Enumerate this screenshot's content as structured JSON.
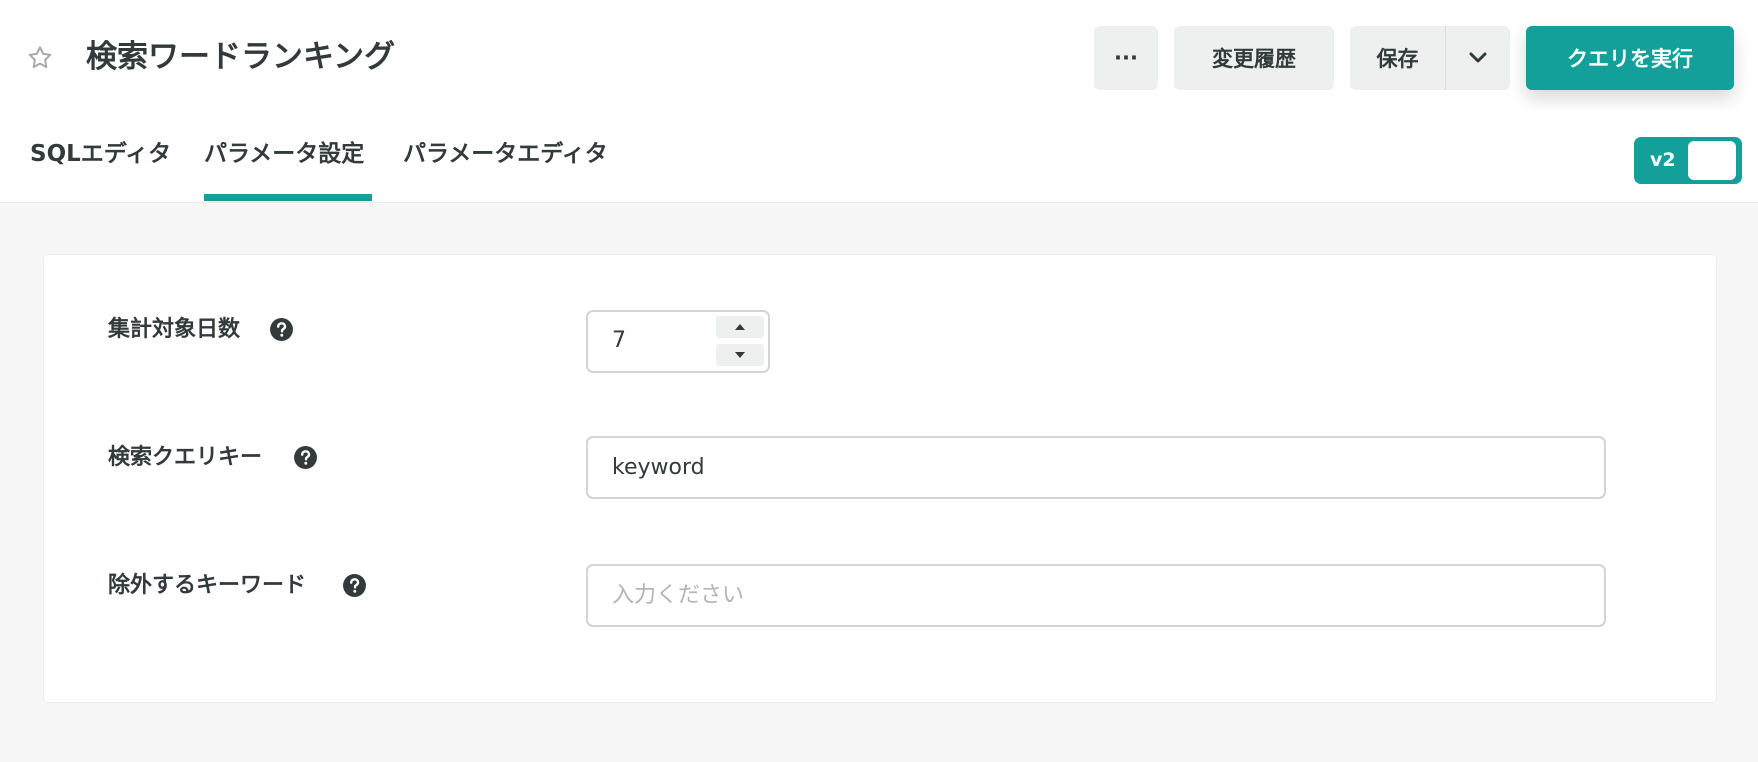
{
  "header": {
    "title": "検索ワードランキング",
    "more_label": "···",
    "history_label": "変更履歴",
    "save_label": "保存",
    "run_label": "クエリを実行"
  },
  "tabs": [
    {
      "label": "SQLエディタ",
      "active": false
    },
    {
      "label": "パラメータ設定",
      "active": true
    },
    {
      "label": "パラメータエディタ",
      "active": false
    }
  ],
  "toggle": {
    "label": "v2",
    "on": true
  },
  "form": {
    "fields": [
      {
        "label": "集計対象日数",
        "value": "7",
        "type": "number",
        "help_icon": "question-circle-icon"
      },
      {
        "label": "検索クエリキー",
        "value": "keyword",
        "type": "text",
        "help_icon": "question-circle-icon"
      },
      {
        "label": "除外するキーワード",
        "value": "",
        "placeholder": "入力ください",
        "type": "text",
        "help_icon": "question-circle-icon"
      }
    ]
  },
  "colors": {
    "accent": "#13a09b",
    "text": "#333a3b",
    "button_bg": "#eef0ef",
    "page_bg": "#f6f6f6"
  }
}
